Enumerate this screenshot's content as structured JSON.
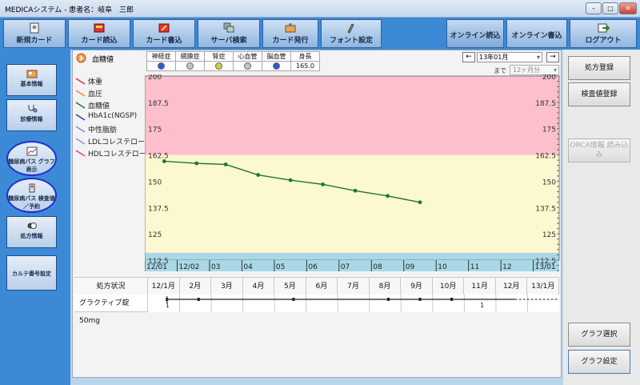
{
  "window": {
    "title": "MEDICAシステム - 患者名：岐阜　三郎"
  },
  "toolbar": {
    "buttons": [
      {
        "label": "新規カード",
        "icon": "new-card-icon"
      },
      {
        "label": "カード読込",
        "icon": "card-read-icon"
      },
      {
        "label": "カード書込",
        "icon": "card-write-icon"
      },
      {
        "label": "サーバ検索",
        "icon": "server-search-icon"
      },
      {
        "label": "カード発行",
        "icon": "card-issue-icon"
      },
      {
        "label": "フォント設定",
        "icon": "font-settings-icon"
      }
    ],
    "online_read": "オンライン読込",
    "online_write": "オンライン書込",
    "logout": "ログアウト"
  },
  "sidebar": {
    "items": [
      {
        "label": "基本情報",
        "icon": "basic-info-icon"
      },
      {
        "label": "診療情報",
        "icon": "stethoscope-icon"
      },
      {
        "label": "糖尿病パス グラフ表示",
        "icon": "graph-icon"
      },
      {
        "label": "糖尿病パス 検査値／予約",
        "icon": "test-value-icon"
      },
      {
        "label": "処方情報",
        "icon": "prescription-icon"
      },
      {
        "label": "カルテ番号設定",
        "icon": ""
      }
    ]
  },
  "header": {
    "selected_item": "血糖値",
    "complications": [
      {
        "label": "神経症",
        "color": "#2d58d8"
      },
      {
        "label": "網膜症",
        "color": "#c4c4c4"
      },
      {
        "label": "腎症",
        "color": "#d8cc3a"
      },
      {
        "label": "心血管",
        "color": "#c4c4c4"
      },
      {
        "label": "脳血管",
        "color": "#2d58d8"
      }
    ],
    "height_label": "身長",
    "height_value": "165.0",
    "date_value": "13年01月",
    "until_label": "まで",
    "period_value": "12ヶ月分",
    "prev_button": "←",
    "next_button": "→"
  },
  "legend": [
    {
      "label": "体重",
      "color": "#e03030"
    },
    {
      "label": "血圧",
      "color": "#f08c2c"
    },
    {
      "label": "血糖値",
      "color": "#1e7a1e"
    },
    {
      "label": "HbA1c(NGSP)",
      "color": "#1f3fc4"
    },
    {
      "label": "中性脂肪",
      "color": "#8a7fd6"
    },
    {
      "label": "LDLコレステロール",
      "color": "#9a8ad0"
    },
    {
      "label": "HDLコレステロール",
      "color": "#e03a9a"
    }
  ],
  "chart_data": {
    "type": "line",
    "title": "",
    "x": [
      "12/01",
      "12/02",
      "03",
      "04",
      "05",
      "06",
      "07",
      "08",
      "09",
      "10",
      "11",
      "12",
      "13/01"
    ],
    "ylim": [
      112.5,
      200
    ],
    "yticks": [
      200,
      187.5,
      175,
      162.5,
      150,
      137.5,
      125,
      112.5
    ],
    "yticks_right": [
      200,
      187.5,
      175,
      162.5,
      150,
      137.5,
      125,
      112.5
    ],
    "bands": [
      {
        "from": 162.5,
        "to": 200,
        "color": "#fdbfcc"
      },
      {
        "from": 116,
        "to": 162.5,
        "color": "#fcf8cf"
      },
      {
        "from": 112.5,
        "to": 116,
        "color": "#a9d8e6"
      }
    ],
    "series": [
      {
        "name": "血糖値",
        "color": "#1e7a1e",
        "points": [
          {
            "x": 0.6,
            "y": 159.5
          },
          {
            "x": 1.6,
            "y": 158.5
          },
          {
            "x": 2.5,
            "y": 158
          },
          {
            "x": 3.5,
            "y": 153
          },
          {
            "x": 4.5,
            "y": 150.5
          },
          {
            "x": 5.5,
            "y": 148.5
          },
          {
            "x": 6.5,
            "y": 145.5
          },
          {
            "x": 7.5,
            "y": 143
          },
          {
            "x": 8.5,
            "y": 140
          }
        ]
      }
    ],
    "grid": true
  },
  "prescription": {
    "header_label": "処方状況",
    "months": [
      "12/1月",
      "2月",
      "3月",
      "4月",
      "5月",
      "6月",
      "7月",
      "8月",
      "9月",
      "10月",
      "11月",
      "12月",
      "13/1月"
    ],
    "drug": "グラクティブ錠50mg",
    "markers": [
      "1",
      "1"
    ]
  },
  "right_buttons": {
    "prescription_register": "処方登録",
    "test_register": "検査値登録",
    "orca": "ORCA情報 読み込み",
    "graph_select": "グラフ選択",
    "graph_settings": "グラフ設定"
  }
}
